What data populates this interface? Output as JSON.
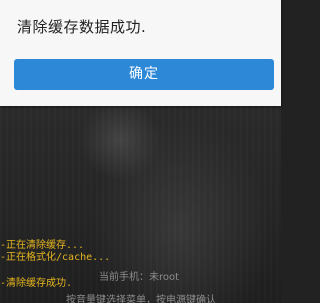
{
  "dialog": {
    "message": "清除缓存数据成功.",
    "confirm_label": "确定",
    "button_color": "#2d89d8"
  },
  "log": {
    "lines": [
      "-正在清除缓存...",
      "-正在格式化/cache...",
      "-清除缓存成功."
    ],
    "color": "#e5b51e"
  },
  "status": {
    "current_phone": "当前手机：未root",
    "hint": "按音量键选择菜单，按电源键确认"
  }
}
